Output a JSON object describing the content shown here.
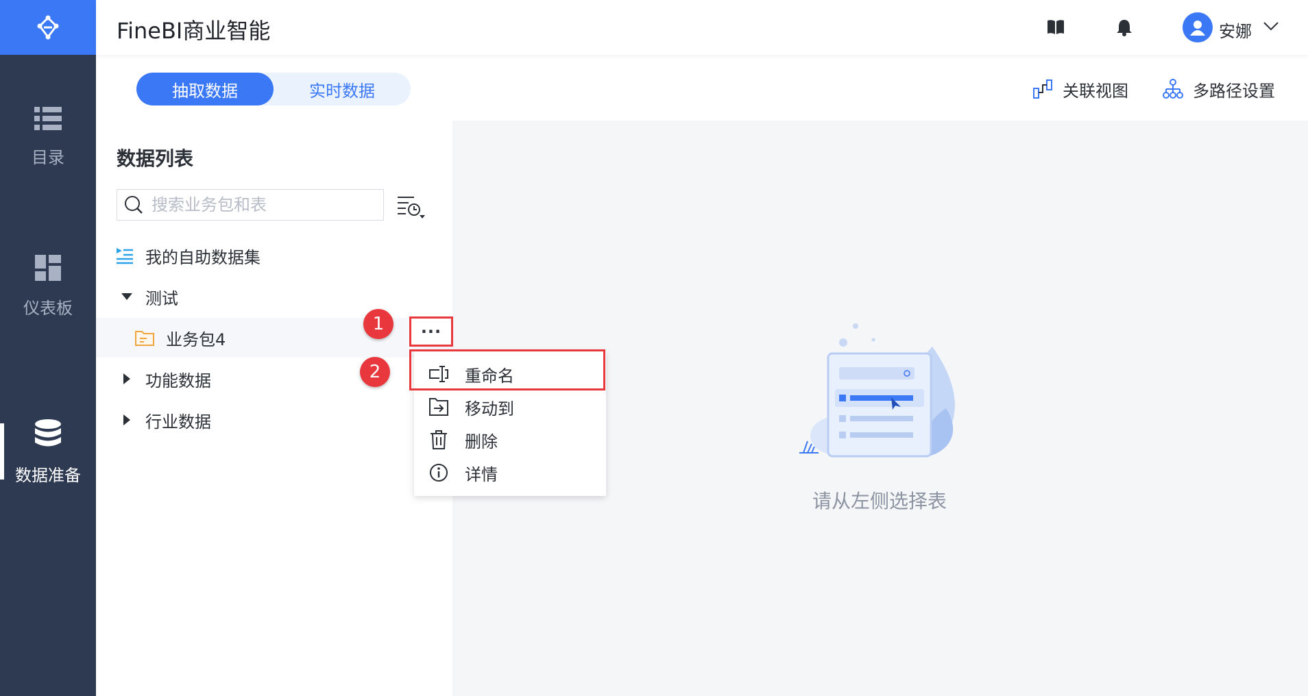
{
  "app": {
    "title": "FineBI商业智能"
  },
  "rail": {
    "items": [
      {
        "label": "目录",
        "icon": "list-icon"
      },
      {
        "label": "仪表板",
        "icon": "dashboard-icon"
      },
      {
        "label": "数据准备",
        "icon": "database-icon",
        "active": true
      }
    ]
  },
  "header": {
    "username": "安娜"
  },
  "tabs": {
    "extract": "抽取数据",
    "realtime": "实时数据",
    "active": "抽取数据"
  },
  "toolbar": {
    "relation_view": "关联视图",
    "multipath": "多路径设置"
  },
  "panel": {
    "title": "数据列表",
    "search_placeholder": "搜索业务包和表",
    "tree": [
      {
        "label": "我的自助数据集",
        "type": "dataset"
      },
      {
        "label": "测试",
        "type": "group",
        "expanded": true
      },
      {
        "label": "业务包4",
        "type": "package",
        "selected": true
      },
      {
        "label": "功能数据",
        "type": "group",
        "expanded": false
      },
      {
        "label": "行业数据",
        "type": "group",
        "expanded": false
      }
    ]
  },
  "more_button": "···",
  "annotations": {
    "badge1": "1",
    "badge2": "2"
  },
  "context_menu": {
    "items": [
      {
        "label": "重命名",
        "icon": "rename-icon"
      },
      {
        "label": "移动到",
        "icon": "move-icon"
      },
      {
        "label": "删除",
        "icon": "trash-icon"
      },
      {
        "label": "详情",
        "icon": "info-icon"
      }
    ]
  },
  "empty_state": {
    "text": "请从左侧选择表"
  },
  "colors": {
    "primary": "#3b78f6",
    "rail": "#2e3a52",
    "highlight": "#e8383d"
  }
}
